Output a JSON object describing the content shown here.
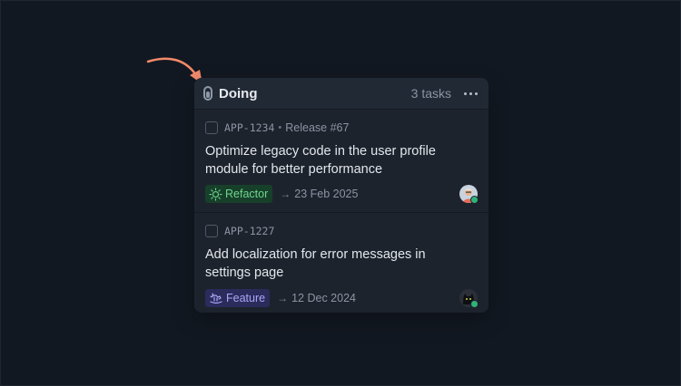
{
  "colors": {
    "background": "#121821",
    "column_bg": "#1b212b",
    "header_bg": "#212935",
    "arrow": "#f28a6b",
    "refactor_bg": "#17402a",
    "refactor_fg": "#6fd58e",
    "feature_bg": "#2b2b5c",
    "feature_fg": "#a9a8f6",
    "presence_online": "#2fb37a"
  },
  "column": {
    "title": "Doing",
    "count_label": "3 tasks",
    "status_icon": "in-progress-pill-icon",
    "menu_icon": "more-horizontal-icon"
  },
  "tasks": [
    {
      "id": "APP-1234",
      "separator": "•",
      "release": "Release #67",
      "title": "Optimize legacy code in the user profile module for better performance",
      "label": "Refactor",
      "label_icon": "sun-icon",
      "due_arrow": "→",
      "due": "23 Feb 2025",
      "assignee_icon": "avatar-person-icon"
    },
    {
      "id": "APP-1227",
      "title": "Add localization for error messages in settings page",
      "label": "Feature",
      "label_icon": "rocking-horse-icon",
      "due_arrow": "→",
      "due": "12 Dec 2024",
      "assignee_icon": "avatar-cat-icon"
    }
  ]
}
